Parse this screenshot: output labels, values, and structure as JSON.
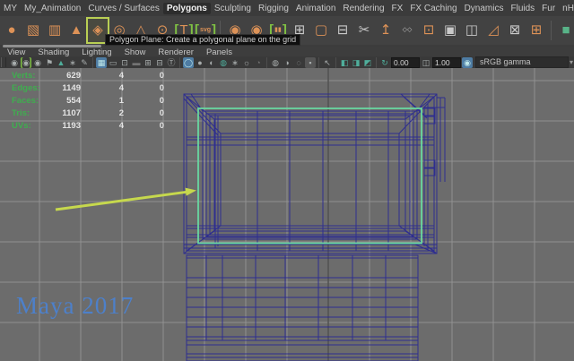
{
  "window": {
    "app": "Maya 2017"
  },
  "menu_bar": {
    "items": [
      {
        "label": "MY",
        "active": false
      },
      {
        "label": "My_Animation",
        "active": false
      },
      {
        "label": "Curves / Surfaces",
        "active": false
      },
      {
        "label": "Polygons",
        "active": true
      },
      {
        "label": "Sculpting",
        "active": false
      },
      {
        "label": "Rigging",
        "active": false
      },
      {
        "label": "Animation",
        "active": false
      },
      {
        "label": "Rendering",
        "active": false
      },
      {
        "label": "FX",
        "active": false
      },
      {
        "label": "FX Caching",
        "active": false
      },
      {
        "label": "Dynamics",
        "active": false
      },
      {
        "label": "Fluids",
        "active": false
      },
      {
        "label": "Fur",
        "active": false
      },
      {
        "label": "nHair",
        "active": false
      }
    ]
  },
  "shelf": {
    "tooltip": "Polygon Plane: Create a polygonal plane on the grid",
    "icons": [
      {
        "name": "poly-sphere-icon",
        "glyph": "●",
        "color": "orange"
      },
      {
        "name": "poly-cube-icon",
        "glyph": "▧",
        "color": "orange"
      },
      {
        "name": "poly-cylinder-icon",
        "glyph": "▥",
        "color": "orange"
      },
      {
        "name": "poly-cone-icon",
        "glyph": "▲",
        "color": "orange"
      },
      {
        "name": "poly-plane-icon",
        "glyph": "◈",
        "color": "orange",
        "highlighted": true
      },
      {
        "name": "poly-torus-icon",
        "glyph": "◎",
        "color": "orange"
      },
      {
        "name": "poly-pyramid-icon",
        "glyph": "△",
        "color": "orange"
      },
      {
        "name": "poly-pipe-icon",
        "glyph": "⊙",
        "color": "orange"
      },
      {
        "name": "poly-text-icon",
        "glyph": "T",
        "color": "orange",
        "bracketed": true
      },
      {
        "name": "poly-svg-icon",
        "glyph": "svg",
        "color": "orange",
        "bracketed": true,
        "small": true
      },
      {
        "divider": true
      },
      {
        "name": "smooth-icon",
        "glyph": "◉",
        "color": "orange"
      },
      {
        "name": "smooth-preview-icon",
        "glyph": "◉",
        "color": "orange"
      },
      {
        "name": "mirror-icon",
        "glyph": "▮▮",
        "color": "orange",
        "bracketed": true,
        "small": true
      },
      {
        "name": "combine-icon",
        "glyph": "⊞",
        "color": "white"
      },
      {
        "name": "wire-cube-icon",
        "glyph": "▢",
        "color": "orange"
      },
      {
        "name": "fill-hole-icon",
        "glyph": "⊟",
        "color": "white"
      },
      {
        "name": "multi-cut-icon",
        "glyph": "✂",
        "color": "white"
      },
      {
        "name": "extrude-icon",
        "glyph": "↥",
        "color": "orange"
      },
      {
        "name": "quad-draw-icon",
        "glyph": "◇◇",
        "color": "white",
        "small": true
      },
      {
        "name": "bevel-icon",
        "glyph": "⊡",
        "color": "orange"
      },
      {
        "name": "target-weld-icon",
        "glyph": "▣",
        "color": "white"
      },
      {
        "name": "bridge-icon",
        "glyph": "◫",
        "color": "white"
      },
      {
        "name": "split-icon",
        "glyph": "◿",
        "color": "orange"
      },
      {
        "name": "delete-edge-icon",
        "glyph": "⊠",
        "color": "white"
      },
      {
        "name": "merge-vertex-icon",
        "glyph": "⊞",
        "color": "orange"
      },
      {
        "divider": true
      },
      {
        "name": "uv-editor-icon",
        "glyph": "■",
        "color": "teal"
      }
    ]
  },
  "panel_menu": {
    "items": [
      "View",
      "Shading",
      "Lighting",
      "Show",
      "Renderer",
      "Panels"
    ]
  },
  "viewport_toolbar": {
    "exposure_value": "0.00",
    "gamma_value": "1.00",
    "view_transform": "sRGB gamma",
    "dropdown_arrow": "▾",
    "icons": [
      {
        "name": "select-camera-icon",
        "glyph": "◉"
      },
      {
        "name": "bookmark-camera-icon",
        "glyph": "◉",
        "gbracket": true
      },
      {
        "name": "lock-camera-icon",
        "glyph": "◉"
      },
      {
        "name": "bookmark-flag-icon",
        "glyph": "⚑"
      },
      {
        "name": "image-plane-icon",
        "glyph": "▲",
        "teal": true
      },
      {
        "name": "view-axis-icon",
        "glyph": "∗"
      },
      {
        "name": "grease-pencil-icon",
        "glyph": "✎"
      },
      {
        "sep": true
      },
      {
        "name": "grid-icon",
        "glyph": "▦",
        "active": true
      },
      {
        "name": "film-gate-icon",
        "glyph": "▭"
      },
      {
        "name": "resolution-gate-icon",
        "glyph": "⊡"
      },
      {
        "name": "gate-mask-icon",
        "glyph": "▬",
        "dim": true
      },
      {
        "name": "field-chart-icon",
        "glyph": "⊞"
      },
      {
        "name": "safe-action-icon",
        "glyph": "⊟"
      },
      {
        "name": "safe-title-icon",
        "glyph": "Ⓣ"
      },
      {
        "sep": true
      },
      {
        "name": "wireframe-mode-icon",
        "glyph": "◯",
        "active": true
      },
      {
        "name": "shaded-mode-icon",
        "glyph": "●"
      },
      {
        "name": "textured-mode-icon",
        "glyph": "◐"
      },
      {
        "name": "default-material-icon",
        "glyph": "◍",
        "teal": true
      },
      {
        "name": "xray-mode-icon",
        "glyph": "∗"
      },
      {
        "name": "lighting-icon",
        "glyph": "☼"
      },
      {
        "name": "shadows-icon",
        "glyph": "◔",
        "dim": true
      },
      {
        "sep": true
      },
      {
        "name": "exposure-icon",
        "glyph": "◍"
      },
      {
        "name": "contrast-icon",
        "glyph": "◑"
      },
      {
        "name": "gamma-ring-icon",
        "glyph": "◌"
      },
      {
        "name": "background-toggle-icon",
        "glyph": "▪",
        "pressed": true
      },
      {
        "sep": true
      },
      {
        "name": "isolate-select-icon",
        "glyph": "↖"
      },
      {
        "sep": true
      },
      {
        "name": "pane-layout-single-icon",
        "glyph": "◧",
        "teal": true
      },
      {
        "name": "pane-layout-two-icon",
        "glyph": "◨",
        "teal": true
      },
      {
        "name": "pane-layout-four-icon",
        "glyph": "◩",
        "teal": true
      },
      {
        "sep": true
      },
      {
        "name": "refresh-icon",
        "glyph": "↻",
        "teal": true
      }
    ]
  },
  "viewport": {
    "watermark": "Maya 2017",
    "hud": {
      "rows": [
        {
          "label": "Verts:",
          "values": [
            "629",
            "4",
            "0"
          ]
        },
        {
          "label": "Edges:",
          "values": [
            "1149",
            "4",
            "0"
          ]
        },
        {
          "label": "Faces:",
          "values": [
            "554",
            "1",
            "0"
          ]
        },
        {
          "label": "Tris:",
          "values": [
            "1107",
            "2",
            "0"
          ]
        },
        {
          "label": "UVs:",
          "values": [
            "1193",
            "4",
            "0"
          ]
        }
      ]
    },
    "colors": {
      "background": "#6c6c6c",
      "grid_line": "#a8a8a8",
      "grid_axis": "#515151",
      "wireframe": "#2b2b91",
      "selection_green": "#68d7a1",
      "annotation_arrow": "#c6d84d",
      "hud_green": "#3fae4f",
      "watermark_blue": "#4d80ca",
      "icon_orange": "#dd9257",
      "active_blue": "#4e7ca3"
    }
  }
}
